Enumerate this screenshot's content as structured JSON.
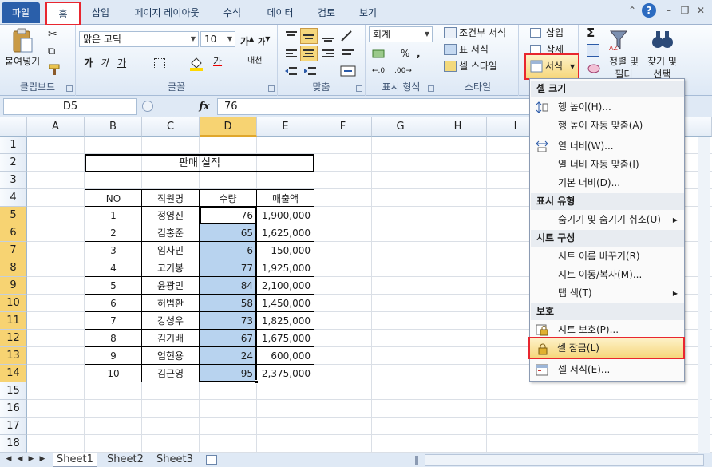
{
  "tabs": {
    "file": "파일",
    "home": "홈",
    "insert": "삽입",
    "page_layout": "페이지 레이아웃",
    "formulas": "수식",
    "data": "데이터",
    "review": "검토",
    "view": "보기"
  },
  "ribbon": {
    "clipboard": {
      "label": "클립보드",
      "paste": "붙여넣기"
    },
    "font": {
      "label": "글꼴",
      "name": "맑은 고딕",
      "size": "10",
      "bold": "가",
      "italic": "가",
      "underline": "가"
    },
    "alignment": {
      "label": "맞춤"
    },
    "number": {
      "label": "표시 형식",
      "format": "회계",
      "percent": "%"
    },
    "styles": {
      "label": "스타일",
      "conditional": "조건부 서식",
      "table": "표 서식",
      "cell": "셀 스타일"
    },
    "cells": {
      "insert": "삽입",
      "delete": "삭제",
      "format": "서식"
    },
    "editing": {
      "sort": "정렬 및",
      "sort2": "필터",
      "find": "찾기 및",
      "find2": "선택",
      "sum": "Σ"
    }
  },
  "formula_bar": {
    "name_box": "D5",
    "fx": "fx",
    "value": "76"
  },
  "grid": {
    "columns": [
      "A",
      "B",
      "C",
      "D",
      "E",
      "F",
      "G",
      "H",
      "I"
    ],
    "rows": [
      "1",
      "2",
      "3",
      "4",
      "5",
      "6",
      "7",
      "8",
      "9",
      "10",
      "11",
      "12",
      "13",
      "14",
      "15",
      "16",
      "17",
      "18"
    ],
    "selected_column": "D",
    "title": "판매 실적",
    "headers": [
      "NO",
      "직원명",
      "수량",
      "매출액"
    ],
    "data": [
      [
        "1",
        "정영진",
        "76",
        "1,900,000"
      ],
      [
        "2",
        "김홍준",
        "65",
        "1,625,000"
      ],
      [
        "3",
        "임사민",
        "6",
        "150,000"
      ],
      [
        "4",
        "고기봉",
        "77",
        "1,925,000"
      ],
      [
        "5",
        "윤광민",
        "84",
        "2,100,000"
      ],
      [
        "6",
        "허범환",
        "58",
        "1,450,000"
      ],
      [
        "7",
        "강성우",
        "73",
        "1,825,000"
      ],
      [
        "8",
        "김기배",
        "67",
        "1,675,000"
      ],
      [
        "9",
        "엄현용",
        "24",
        "600,000"
      ],
      [
        "10",
        "김근영",
        "95",
        "2,375,000"
      ]
    ]
  },
  "sheets": [
    "Sheet1",
    "Sheet2",
    "Sheet3"
  ],
  "menu": {
    "sec_size": "셀 크기",
    "row_height": "행 높이(H)...",
    "row_autofit": "행 높이 자동 맞춤(A)",
    "col_width": "열 너비(W)...",
    "col_autofit": "열 너비 자동 맞춤(I)",
    "default_width": "기본 너비(D)...",
    "sec_visibility": "표시 유형",
    "hide_unhide": "숨기기 및 숨기기 취소(U)",
    "sec_organize": "시트 구성",
    "rename": "시트 이름 바꾸기(R)",
    "move_copy": "시트 이동/복사(M)...",
    "tab_color": "탭 색(T)",
    "sec_protect": "보호",
    "protect_sheet": "시트 보호(P)...",
    "lock_cell": "셀 잠금(L)",
    "format_cells": "셀 서식(E)..."
  },
  "colors": {
    "accent_red": "#e8262f",
    "selection": "#b8d3ef",
    "header_sel": "#f7d372"
  }
}
